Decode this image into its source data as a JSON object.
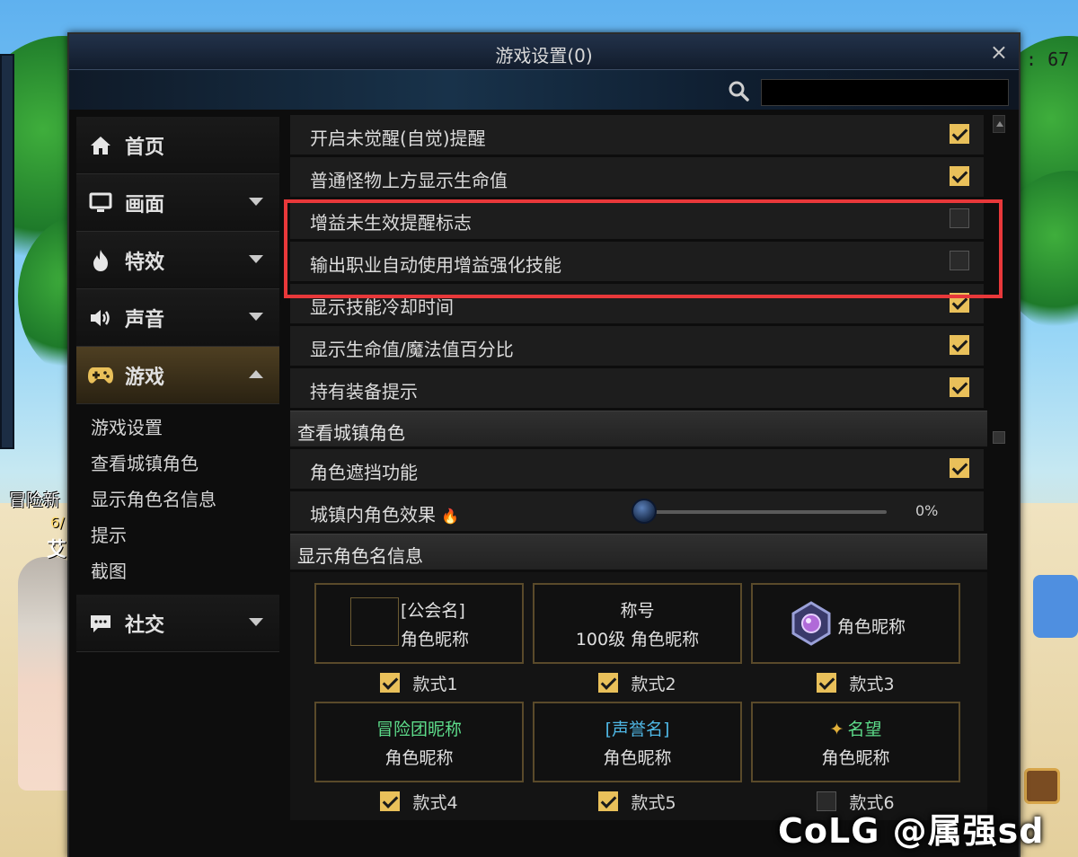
{
  "window": {
    "title": "游戏设置(0)",
    "close": "×"
  },
  "search": {
    "value": ""
  },
  "sidebar": {
    "items": [
      {
        "label": "首页",
        "icon": "home-icon"
      },
      {
        "label": "画面",
        "icon": "monitor-icon"
      },
      {
        "label": "特效",
        "icon": "flame-icon"
      },
      {
        "label": "声音",
        "icon": "speaker-icon"
      },
      {
        "label": "游戏",
        "icon": "gamepad-icon",
        "active": true
      },
      {
        "label": "社交",
        "icon": "chat-icon"
      }
    ],
    "sub_items": [
      "游戏设置",
      "查看城镇角色",
      "显示角色名信息",
      "提示",
      "截图"
    ]
  },
  "settings": {
    "rows": [
      {
        "label": "开启未觉醒(自觉)提醒",
        "checked": true
      },
      {
        "label": "普通怪物上方显示生命值",
        "checked": true
      },
      {
        "label": "增益未生效提醒标志",
        "checked": false
      },
      {
        "label": "输出职业自动使用增益强化技能",
        "checked": false
      },
      {
        "label": "显示技能冷却时间",
        "checked": true
      },
      {
        "label": "显示生命值/魔法值百分比",
        "checked": true
      },
      {
        "label": "持有装备提示",
        "checked": true
      }
    ],
    "section_town": "查看城镇角色",
    "town_rows": [
      {
        "label": "角色遮挡功能",
        "checked": true
      }
    ],
    "town_effect": {
      "label": "城镇内角色效果",
      "value": "0%",
      "level": 0
    },
    "section_names": "显示角色名信息"
  },
  "name_styles": {
    "cards": [
      {
        "line1": "[公会名]",
        "line2": "角色昵称",
        "style": "款式1",
        "checked": true
      },
      {
        "line1": "称号",
        "line2": "100级 角色昵称",
        "style": "款式2",
        "checked": true
      },
      {
        "line1": "角色昵称",
        "line2": "",
        "style": "款式3",
        "checked": true
      },
      {
        "line1": "冒险团昵称",
        "line2": "角色昵称",
        "style": "款式4",
        "checked": true
      },
      {
        "line1": "[声誉名]",
        "line2": "角色昵称",
        "style": "款式5",
        "checked": true
      },
      {
        "line1": "名望",
        "line2": "角色昵称",
        "style": "款式6",
        "checked": false
      }
    ]
  },
  "hud": {
    "left_name": "冒险新",
    "left_sub": "6/",
    "left_tag": "艾",
    "timer": ": 67"
  },
  "watermark": "CoLG @属强sd",
  "colors": {
    "accent_gold": "#e9c05a",
    "highlight_red": "#e8383a",
    "green_text": "#5ddc8a",
    "blue_text": "#4fb8e6"
  }
}
